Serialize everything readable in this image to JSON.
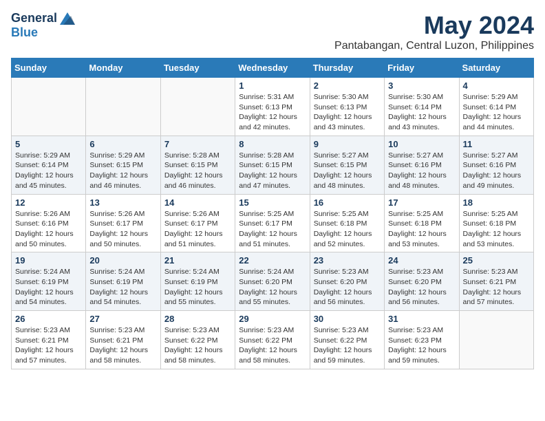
{
  "logo": {
    "general": "General",
    "blue": "Blue"
  },
  "title": {
    "month": "May 2024",
    "location": "Pantabangan, Central Luzon, Philippines"
  },
  "weekdays": [
    "Sunday",
    "Monday",
    "Tuesday",
    "Wednesday",
    "Thursday",
    "Friday",
    "Saturday"
  ],
  "weeks": [
    [
      {
        "day": "",
        "info": ""
      },
      {
        "day": "",
        "info": ""
      },
      {
        "day": "",
        "info": ""
      },
      {
        "day": "1",
        "info": "Sunrise: 5:31 AM\nSunset: 6:13 PM\nDaylight: 12 hours\nand 42 minutes."
      },
      {
        "day": "2",
        "info": "Sunrise: 5:30 AM\nSunset: 6:13 PM\nDaylight: 12 hours\nand 43 minutes."
      },
      {
        "day": "3",
        "info": "Sunrise: 5:30 AM\nSunset: 6:14 PM\nDaylight: 12 hours\nand 43 minutes."
      },
      {
        "day": "4",
        "info": "Sunrise: 5:29 AM\nSunset: 6:14 PM\nDaylight: 12 hours\nand 44 minutes."
      }
    ],
    [
      {
        "day": "5",
        "info": "Sunrise: 5:29 AM\nSunset: 6:14 PM\nDaylight: 12 hours\nand 45 minutes."
      },
      {
        "day": "6",
        "info": "Sunrise: 5:29 AM\nSunset: 6:15 PM\nDaylight: 12 hours\nand 46 minutes."
      },
      {
        "day": "7",
        "info": "Sunrise: 5:28 AM\nSunset: 6:15 PM\nDaylight: 12 hours\nand 46 minutes."
      },
      {
        "day": "8",
        "info": "Sunrise: 5:28 AM\nSunset: 6:15 PM\nDaylight: 12 hours\nand 47 minutes."
      },
      {
        "day": "9",
        "info": "Sunrise: 5:27 AM\nSunset: 6:15 PM\nDaylight: 12 hours\nand 48 minutes."
      },
      {
        "day": "10",
        "info": "Sunrise: 5:27 AM\nSunset: 6:16 PM\nDaylight: 12 hours\nand 48 minutes."
      },
      {
        "day": "11",
        "info": "Sunrise: 5:27 AM\nSunset: 6:16 PM\nDaylight: 12 hours\nand 49 minutes."
      }
    ],
    [
      {
        "day": "12",
        "info": "Sunrise: 5:26 AM\nSunset: 6:16 PM\nDaylight: 12 hours\nand 50 minutes."
      },
      {
        "day": "13",
        "info": "Sunrise: 5:26 AM\nSunset: 6:17 PM\nDaylight: 12 hours\nand 50 minutes."
      },
      {
        "day": "14",
        "info": "Sunrise: 5:26 AM\nSunset: 6:17 PM\nDaylight: 12 hours\nand 51 minutes."
      },
      {
        "day": "15",
        "info": "Sunrise: 5:25 AM\nSunset: 6:17 PM\nDaylight: 12 hours\nand 51 minutes."
      },
      {
        "day": "16",
        "info": "Sunrise: 5:25 AM\nSunset: 6:18 PM\nDaylight: 12 hours\nand 52 minutes."
      },
      {
        "day": "17",
        "info": "Sunrise: 5:25 AM\nSunset: 6:18 PM\nDaylight: 12 hours\nand 53 minutes."
      },
      {
        "day": "18",
        "info": "Sunrise: 5:25 AM\nSunset: 6:18 PM\nDaylight: 12 hours\nand 53 minutes."
      }
    ],
    [
      {
        "day": "19",
        "info": "Sunrise: 5:24 AM\nSunset: 6:19 PM\nDaylight: 12 hours\nand 54 minutes."
      },
      {
        "day": "20",
        "info": "Sunrise: 5:24 AM\nSunset: 6:19 PM\nDaylight: 12 hours\nand 54 minutes."
      },
      {
        "day": "21",
        "info": "Sunrise: 5:24 AM\nSunset: 6:19 PM\nDaylight: 12 hours\nand 55 minutes."
      },
      {
        "day": "22",
        "info": "Sunrise: 5:24 AM\nSunset: 6:20 PM\nDaylight: 12 hours\nand 55 minutes."
      },
      {
        "day": "23",
        "info": "Sunrise: 5:23 AM\nSunset: 6:20 PM\nDaylight: 12 hours\nand 56 minutes."
      },
      {
        "day": "24",
        "info": "Sunrise: 5:23 AM\nSunset: 6:20 PM\nDaylight: 12 hours\nand 56 minutes."
      },
      {
        "day": "25",
        "info": "Sunrise: 5:23 AM\nSunset: 6:21 PM\nDaylight: 12 hours\nand 57 minutes."
      }
    ],
    [
      {
        "day": "26",
        "info": "Sunrise: 5:23 AM\nSunset: 6:21 PM\nDaylight: 12 hours\nand 57 minutes."
      },
      {
        "day": "27",
        "info": "Sunrise: 5:23 AM\nSunset: 6:21 PM\nDaylight: 12 hours\nand 58 minutes."
      },
      {
        "day": "28",
        "info": "Sunrise: 5:23 AM\nSunset: 6:22 PM\nDaylight: 12 hours\nand 58 minutes."
      },
      {
        "day": "29",
        "info": "Sunrise: 5:23 AM\nSunset: 6:22 PM\nDaylight: 12 hours\nand 58 minutes."
      },
      {
        "day": "30",
        "info": "Sunrise: 5:23 AM\nSunset: 6:22 PM\nDaylight: 12 hours\nand 59 minutes."
      },
      {
        "day": "31",
        "info": "Sunrise: 5:23 AM\nSunset: 6:23 PM\nDaylight: 12 hours\nand 59 minutes."
      },
      {
        "day": "",
        "info": ""
      }
    ]
  ]
}
